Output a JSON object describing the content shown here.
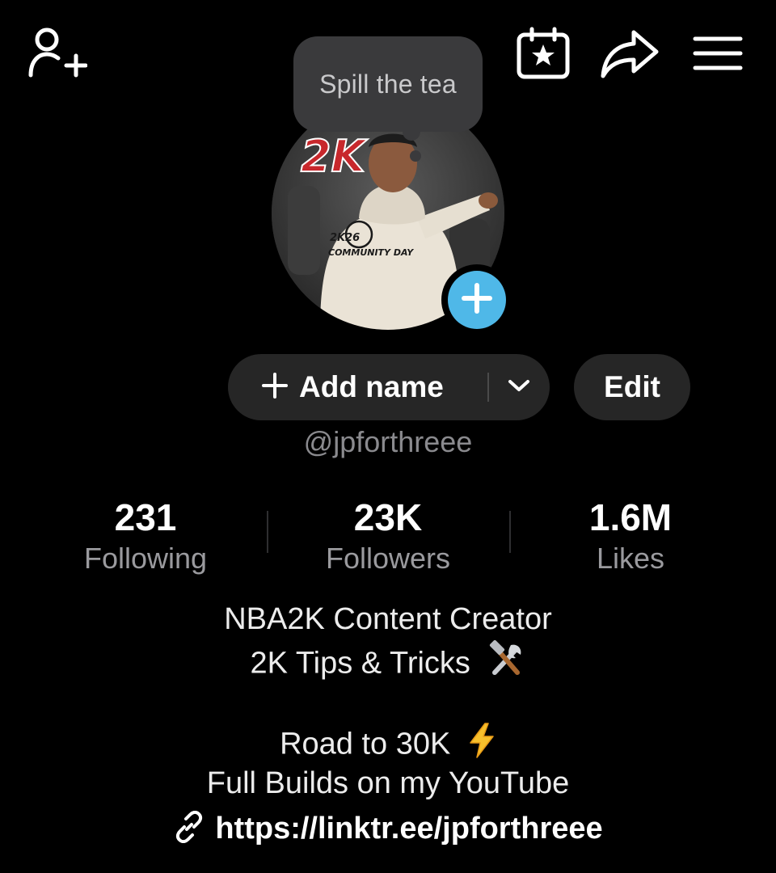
{
  "top_bar": {
    "add_friend_icon": "person-plus-icon",
    "events_icon": "calendar-star-icon",
    "share_icon": "share-arrow-icon",
    "menu_icon": "hamburger-menu-icon"
  },
  "tooltip": {
    "text": "Spill the tea"
  },
  "avatar": {
    "add_icon": "plus-icon",
    "accent_color": "#4fb8e8",
    "logo_text": "2K",
    "shirt_text_line1": "2K26",
    "shirt_text_line2": "COMMUNITY DAY"
  },
  "profile_actions": {
    "add_name_label": "Add name",
    "edit_label": "Edit"
  },
  "username": "@jpforthreee",
  "stats": [
    {
      "value": "231",
      "label": "Following"
    },
    {
      "value": "23K",
      "label": "Followers"
    },
    {
      "value": "1.6M",
      "label": "Likes"
    }
  ],
  "bio": {
    "line1": "NBA2K Content Creator",
    "line2": "2K Tips & Tricks",
    "line2_emoji": "hammer-and-wrench-icon",
    "line3": "Road to 30K",
    "line3_emoji": "high-voltage-icon",
    "line4": "Full Builds on my YouTube",
    "link": "https://linktr.ee/jpforthreee"
  }
}
